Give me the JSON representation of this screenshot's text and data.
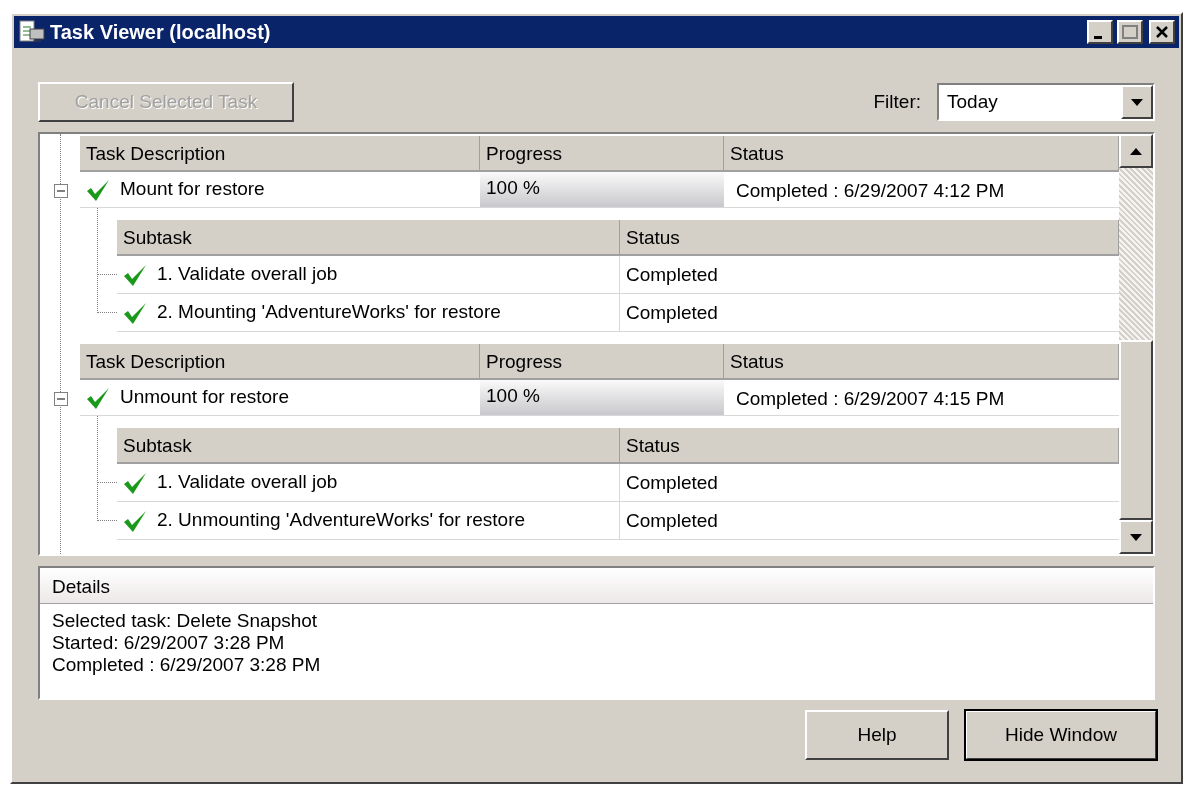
{
  "window": {
    "title": "Task Viewer (localhost)"
  },
  "toolbar": {
    "cancel_button": {
      "label": "Cancel Selected Task",
      "disabled": true
    },
    "filter": {
      "label": "Filter:",
      "value": "Today"
    }
  },
  "tasks": [
    {
      "columns": [
        "Task Description",
        "Progress",
        "Status"
      ],
      "description": "Mount for restore",
      "expanded": true,
      "progress_text": "100 %",
      "level": 1,
      "status": "Completed : 6/29/2007 4:12 PM",
      "subtask_columns": [
        "Subtask",
        "Status"
      ],
      "subtasks": [
        {
          "name": "1. Validate overall job",
          "status": "Completed"
        },
        {
          "name": "2. Mounting 'AdventureWorks' for restore",
          "status": "Completed"
        }
      ]
    },
    {
      "columns": [
        "Task Description",
        "Progress",
        "Status"
      ],
      "description": "Unmount for restore",
      "expanded": true,
      "progress_text": "100 %",
      "level": 1,
      "status": "Completed : 6/29/2007 4:15 PM",
      "subtask_columns": [
        "Subtask",
        "Status"
      ],
      "subtasks": [
        {
          "name": "1. Validate overall job",
          "status": "Completed"
        },
        {
          "name": "2. Unmounting 'AdventureWorks' for restore",
          "status": "Completed"
        }
      ]
    }
  ],
  "details": {
    "title": "Details",
    "lines": [
      "Selected task: Delete Snapshot",
      "Started: 6/29/2007 3:28 PM",
      "Completed : 6/29/2007 3:28 PM"
    ]
  },
  "buttons": [
    {
      "label": "Help",
      "default": false
    },
    {
      "label": "Hide Window",
      "default": true
    }
  ]
}
